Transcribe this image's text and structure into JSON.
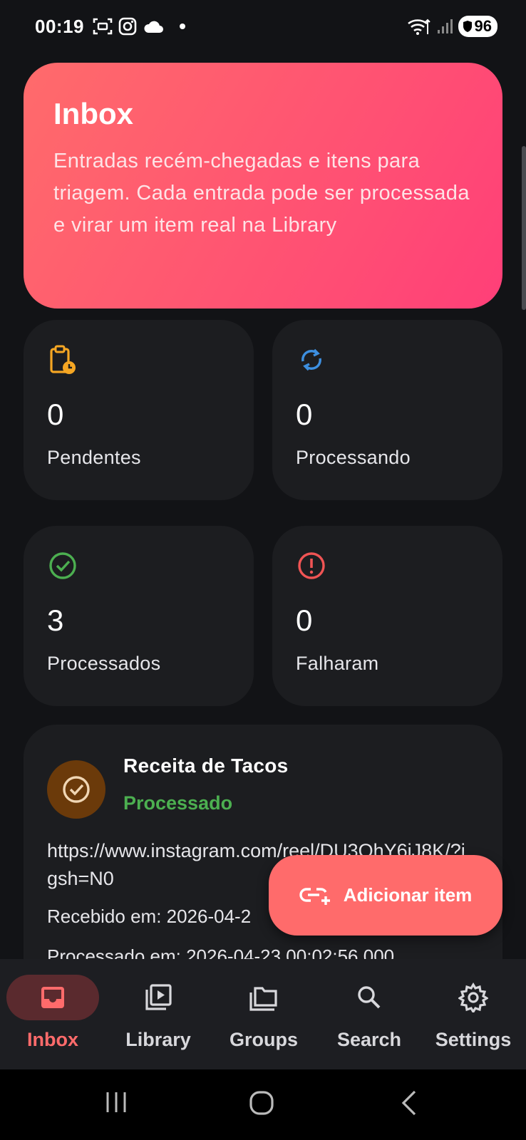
{
  "status_bar": {
    "time": "00:19",
    "battery": "96",
    "icons_left": [
      "screenshot-icon",
      "instagram-icon",
      "cloud-icon",
      "notification-dot"
    ],
    "icons_right": [
      "wifi-icon",
      "signal-icon",
      "battery-icon"
    ]
  },
  "hero": {
    "title": "Inbox",
    "description": "Entradas recém-chegadas e itens para triagem. Cada entrada pode ser processada e virar um item real na Library"
  },
  "stats": [
    {
      "icon": "clipboard-clock-icon",
      "value": "0",
      "label": "Pendentes",
      "color": "#f5a623"
    },
    {
      "icon": "sync-icon",
      "value": "0",
      "label": "Processando",
      "color": "#3d8fe0"
    },
    {
      "icon": "check-circle-icon",
      "value": "3",
      "label": "Processados",
      "color": "#4caf50"
    },
    {
      "icon": "alert-circle-icon",
      "value": "0",
      "label": "Falharam",
      "color": "#f05454"
    }
  ],
  "entry": {
    "title": "Receita de Tacos",
    "status": "Processado",
    "url": "https://www.instagram.com/reel/DU3QhY6iJ8K/?igsh=N0",
    "received": "Recebido em: 2026-04-2",
    "processed": "Processado em: 2026-04-23 00:02:56.000"
  },
  "fab": {
    "label": "Adicionar item",
    "icon": "add-link-icon"
  },
  "nav": {
    "active": "Inbox",
    "items": [
      {
        "label": "Inbox",
        "icon": "inbox-icon"
      },
      {
        "label": "Library",
        "icon": "video-library-icon"
      },
      {
        "label": "Groups",
        "icon": "folders-icon"
      },
      {
        "label": "Search",
        "icon": "search-icon"
      },
      {
        "label": "Settings",
        "icon": "gear-icon"
      }
    ]
  },
  "colors": {
    "accent": "#ff6b6b",
    "background": "#121316",
    "card": "#1c1d20",
    "success": "#4caf50"
  }
}
